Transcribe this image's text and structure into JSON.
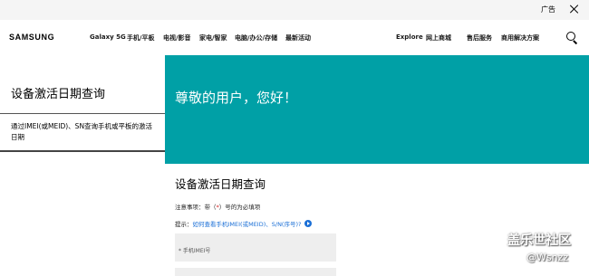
{
  "ad_bar": {
    "label": "广告"
  },
  "header": {
    "logo": "SAMSUNG",
    "nav_left": [
      "Galaxy 5G",
      "手机/平板",
      "电视/影音",
      "家电/智家",
      "电脑/办公/存储",
      "最新活动"
    ],
    "nav_right": [
      "Explore",
      "网上商城",
      "售后服务",
      "商用解决方案"
    ]
  },
  "left_panel": {
    "title": "设备激活日期查询",
    "subtitle": "通过IMEI(或MEID)、SN查询手机或平板的激活日期"
  },
  "hero": {
    "title": "尊敬的用户，您好！",
    "bg_color": "#00a0a6"
  },
  "form": {
    "title": "设备激活日期查询",
    "note_prefix": "注意事项：带（",
    "note_required_mark": "*",
    "note_suffix": "）号的为必填项",
    "tip_prefix": "提示：",
    "tip_link": "如何查看手机IMEI(或MEID)、S/N(序号)?",
    "imei_placeholder": "* 手机IMEI号"
  },
  "watermark": {
    "title": "盖乐世社区",
    "handle": "@Wsnzz"
  }
}
